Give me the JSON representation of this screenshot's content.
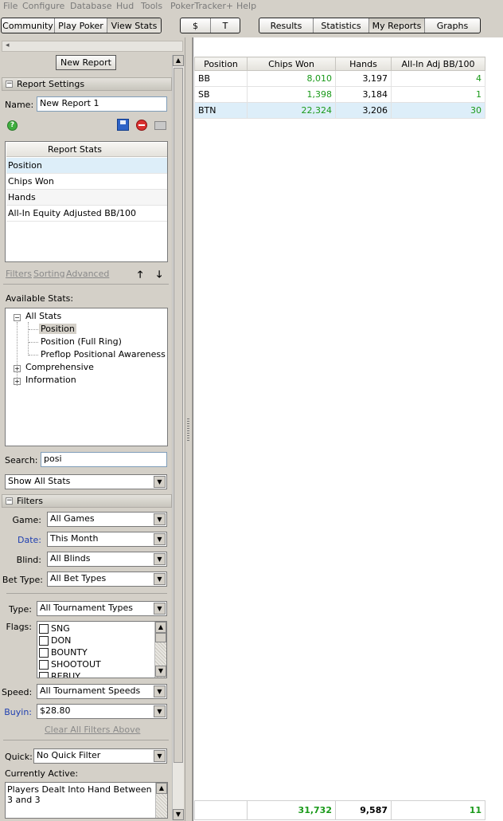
{
  "menu": [
    "File",
    "Configure",
    "Database",
    "Hud",
    "Tools",
    "PokerTracker+",
    "Help"
  ],
  "toolbar": {
    "group1": [
      {
        "label": "Community"
      },
      {
        "label": "Play Poker"
      },
      {
        "label": "View Stats",
        "active": true
      }
    ],
    "group2": [
      {
        "label": "$"
      },
      {
        "label": "T"
      }
    ],
    "group3": [
      {
        "label": "Results"
      },
      {
        "label": "Statistics"
      },
      {
        "label": "My Reports",
        "active": true
      },
      {
        "label": "Graphs"
      }
    ]
  },
  "left": {
    "new_report_label": "New Report",
    "report_settings": "Report Settings",
    "name_label": "Name:",
    "name_value": "New Report 1",
    "report_stats_header": "Report Stats",
    "report_stats": [
      "Position",
      "Chips Won",
      "Hands",
      "All-In Equity Adjusted BB/100"
    ],
    "links": [
      "Filters",
      "Sorting",
      "Advanced"
    ],
    "available_stats_label": "Available Stats:",
    "tree": {
      "all_stats": "All Stats",
      "children": [
        "Position",
        "Position (Full Ring)",
        "Preflop Positional Awareness"
      ],
      "other": [
        "Comprehensive",
        "Information"
      ]
    },
    "search_label": "Search:",
    "search_value": "posi",
    "show_filter": "Show All Stats",
    "filters_header": "Filters",
    "game_label": "Game:",
    "game_value": "All Games",
    "date_label": "Date:",
    "date_value": "This Month",
    "blind_label": "Blind:",
    "blind_value": "All Blinds",
    "bettype_label": "Bet Type:",
    "bettype_value": "All Bet Types",
    "type_label": "Type:",
    "type_value": "All Tournament Types",
    "flags_label": "Flags:",
    "flags": [
      "SNG",
      "DON",
      "BOUNTY",
      "SHOOTOUT",
      "REBUY"
    ],
    "speed_label": "Speed:",
    "speed_value": "All Tournament Speeds",
    "buyin_label": "Buyin:",
    "buyin_value": "$28.80",
    "clear_filters": "Clear All Filters Above",
    "quick_label": "Quick:",
    "quick_value": "No Quick Filter",
    "currently_active_label": "Currently Active:",
    "currently_active_text": "Players Dealt Into Hand Between 3 and 3"
  },
  "grid": {
    "headers": [
      "Position",
      "Chips Won",
      "Hands",
      "All-In Adj BB/100"
    ],
    "rows": [
      [
        "BB",
        "8,010",
        "3,197",
        "4"
      ],
      [
        "SB",
        "1,398",
        "3,184",
        "1"
      ],
      [
        "BTN",
        "22,324",
        "3,206",
        "30"
      ]
    ],
    "totals": [
      "",
      "31,732",
      "9,587",
      "11"
    ]
  },
  "colors": {
    "accent_green": "#1a9a1a",
    "selected_row": "#ddeef9",
    "link_blue": "#1f3fb0"
  }
}
